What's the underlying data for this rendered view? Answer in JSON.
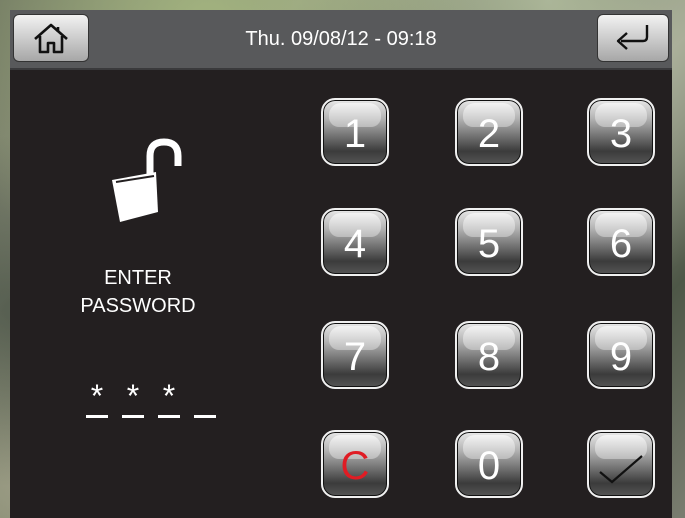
{
  "header": {
    "datetime": "Thu. 09/08/12 - 09:18"
  },
  "icons": {
    "home": "home-icon",
    "back": "return-arrow-icon",
    "lock": "unlocked-padlock-icon",
    "confirm": "checkmark-icon"
  },
  "prompt": {
    "line1": "ENTER",
    "line2": "PASSWORD"
  },
  "password": {
    "masked": [
      "*",
      "*",
      "*",
      ""
    ]
  },
  "keypad": {
    "k1": "1",
    "k2": "2",
    "k3": "3",
    "k4": "4",
    "k5": "5",
    "k6": "6",
    "k7": "7",
    "k8": "8",
    "k9": "9",
    "clear": "C",
    "k0": "0"
  },
  "colors": {
    "panel": "#231f20",
    "topbar": "#58595b",
    "clear_key_text": "#e01c24"
  }
}
